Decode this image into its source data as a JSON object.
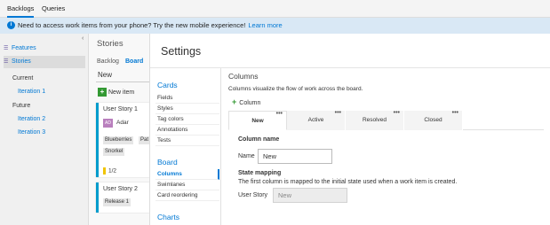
{
  "topnav": {
    "tabs": [
      {
        "label": "Backlogs",
        "active": true
      },
      {
        "label": "Queries",
        "active": false
      }
    ]
  },
  "banner": {
    "message": "Need to access work items from your phone? Try the new mobile experience!",
    "link": "Learn more"
  },
  "left_panel": {
    "items": [
      {
        "label": "Features",
        "icon": "backlog-icon"
      },
      {
        "label": "Stories",
        "icon": "backlog-icon",
        "selected": true
      }
    ],
    "current_label": "Current",
    "current_iterations": [
      "Iteration 1"
    ],
    "future_label": "Future",
    "future_iterations": [
      "Iteration 2",
      "Iteration 3"
    ]
  },
  "board": {
    "title": "Stories",
    "subnav": [
      "Backlog",
      "Board"
    ],
    "column_header": "New",
    "new_item_label": "New item",
    "cards": [
      {
        "title": "User Story 1",
        "assignee": "Adar",
        "tags": [
          "Blueberries",
          "Pat",
          "Snorkel"
        ],
        "task_progress": "1/2"
      },
      {
        "title": "User Story 2",
        "tags": [
          "Release 1"
        ]
      }
    ],
    "accent_color": "#009ccc"
  },
  "settings": {
    "title": "Settings",
    "nav": {
      "cards": {
        "label": "Cards",
        "items": [
          "Fields",
          "Styles",
          "Tag colors",
          "Annotations",
          "Tests"
        ]
      },
      "board": {
        "label": "Board",
        "items": [
          "Columns",
          "Swimlanes",
          "Card reordering"
        ],
        "selected": "Columns"
      },
      "charts": {
        "label": "Charts"
      }
    },
    "content": {
      "heading": "Columns",
      "description": "Columns visualize the flow of work across the board.",
      "add_column_label": "Column",
      "tabs": [
        {
          "label": "New",
          "active": true
        },
        {
          "label": "Active",
          "active": false
        },
        {
          "label": "Resolved",
          "active": false
        },
        {
          "label": "Closed",
          "active": false
        }
      ],
      "more_glyph": "•••",
      "column_name_heading": "Column name",
      "name_label": "Name",
      "name_value": "New",
      "state_mapping_heading": "State mapping",
      "state_mapping_desc": "The first column is mapped to the initial state used when a work item is created.",
      "user_story_label": "User Story",
      "user_story_value": "New"
    }
  }
}
